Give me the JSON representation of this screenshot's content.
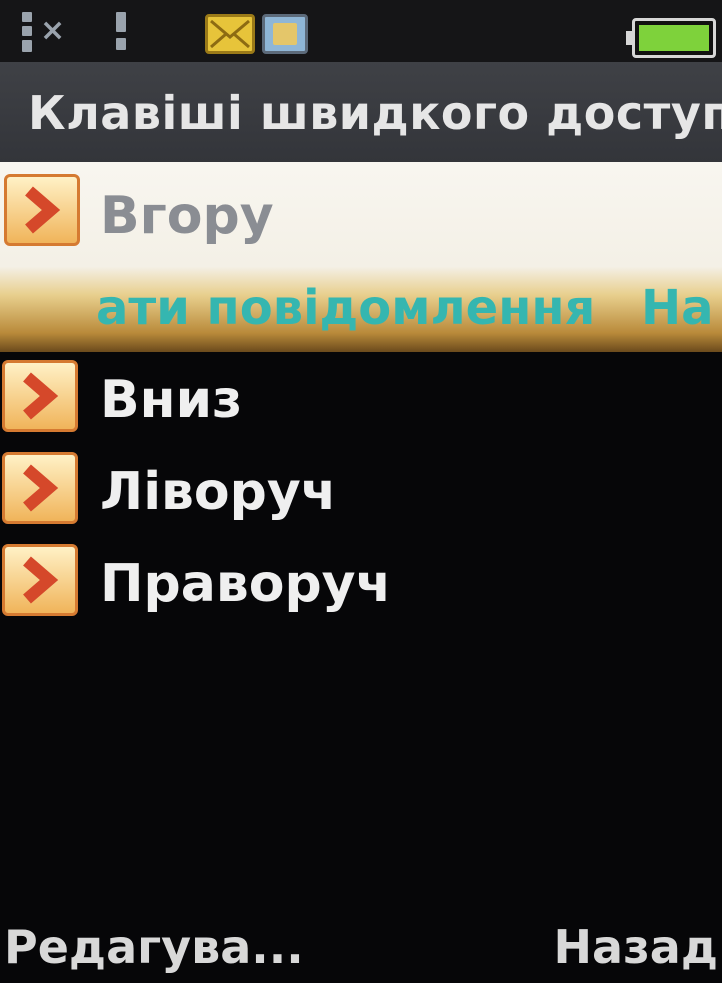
{
  "status_bar": {
    "icons": [
      "signal-icon",
      "no-signal-x-icon",
      "signal2-icon",
      "message-envelope-icon",
      "sim-card-icon",
      "battery-icon"
    ],
    "battery_color": "#7ed23b"
  },
  "header": {
    "title": "Клавіші швидкого доступу"
  },
  "menu": {
    "items": [
      {
        "label": "Вгору",
        "selected": true,
        "assigned_marquee_left": "ати повідомлення",
        "assigned_marquee_right": "На"
      },
      {
        "label": "Вниз",
        "selected": false
      },
      {
        "label": "Ліворуч",
        "selected": false
      },
      {
        "label": "Праворуч",
        "selected": false
      }
    ]
  },
  "softkeys": {
    "left": "Редагува...",
    "right": "Назад"
  },
  "colors": {
    "selected_bg": "#f4f0e6",
    "selected_label": "#8a8d93",
    "marquee_text": "#35b6b0",
    "item_text": "#efefef",
    "accent_arrow": "#d5482a"
  }
}
